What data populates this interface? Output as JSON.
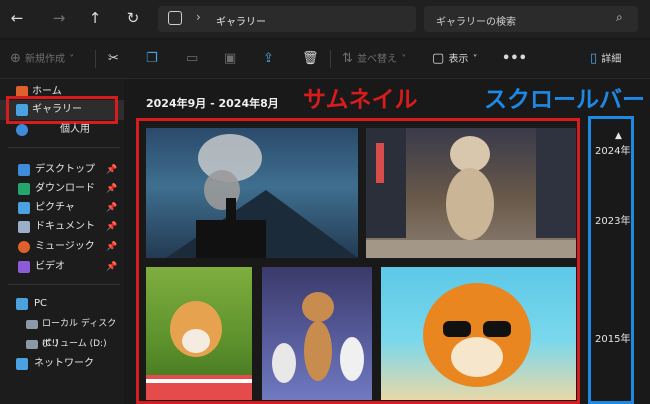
{
  "address": {
    "breadcrumb": "ギャラリー"
  },
  "search": {
    "placeholder": "ギャラリーの検索"
  },
  "toolbar": {
    "new_label": "新規作成",
    "sort_label": "並べ替え",
    "view_label": "表示",
    "details_label": "詳細"
  },
  "sidebar": {
    "home": "ホーム",
    "gallery": "ギャラリー",
    "personal": "個人用",
    "quick_access": [
      {
        "label": "デスクトップ",
        "color": "#3d8bd9"
      },
      {
        "label": "ダウンロード",
        "color": "#22a66e"
      },
      {
        "label": "ピクチャ",
        "color": "#4aa3e0"
      },
      {
        "label": "ドキュメント",
        "color": "#9bb0c8"
      },
      {
        "label": "ミュージック",
        "color": "#e0602d"
      },
      {
        "label": "ビデオ",
        "color": "#8e5bd6"
      }
    ],
    "this_pc": "PC",
    "drives": [
      "ローカル ディスク (C:)",
      "ボリューム (D:)"
    ],
    "network": "ネットワーク"
  },
  "gallery": {
    "date_range": "2024年9月 - 2024年8月"
  },
  "annotations": {
    "thumbnail_label": "サムネイル",
    "scrollbar_label": "スクロールバー"
  },
  "timeline": {
    "years": [
      "2024年",
      "2023年",
      "2015年"
    ]
  },
  "colors": {
    "annotation_red": "#d61c1c",
    "annotation_blue": "#1e88e5"
  }
}
